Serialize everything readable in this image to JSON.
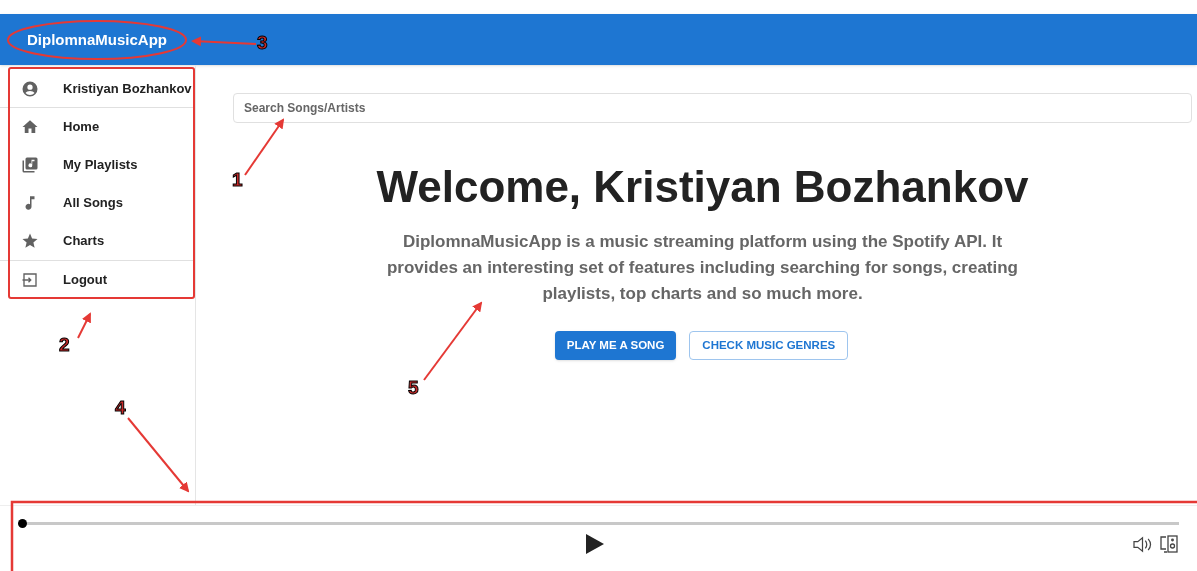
{
  "app_bar": {
    "title": "DiplomnaMusicApp"
  },
  "sidebar": {
    "items": [
      {
        "kind": "user",
        "label": "Kristiyan Bozhankov"
      },
      {
        "kind": "home",
        "label": "Home"
      },
      {
        "kind": "playlists",
        "label": "My Playlists"
      },
      {
        "kind": "songs",
        "label": "All Songs"
      },
      {
        "kind": "charts",
        "label": "Charts"
      },
      {
        "kind": "logout",
        "label": "Logout"
      }
    ]
  },
  "search": {
    "placeholder": "Search Songs/Artists"
  },
  "hero": {
    "title": "Welcome, Kristiyan Bozhankov",
    "description": "DiplomnaMusicApp is a music streaming platform using the Spotify API. It provides an interesting set of features including searching for songs, creating playlists, top charts and so much more.",
    "buttons": [
      {
        "kind": "primary",
        "label": "PLAY ME A SONG"
      },
      {
        "kind": "outlined",
        "label": "CHECK MUSIC GENRES"
      }
    ]
  },
  "player": {
    "progress": {
      "level": 0
    }
  },
  "annotations": [
    {
      "label": "1"
    },
    {
      "label": "2"
    },
    {
      "label": "3"
    },
    {
      "label": "4"
    },
    {
      "label": "5"
    }
  ]
}
